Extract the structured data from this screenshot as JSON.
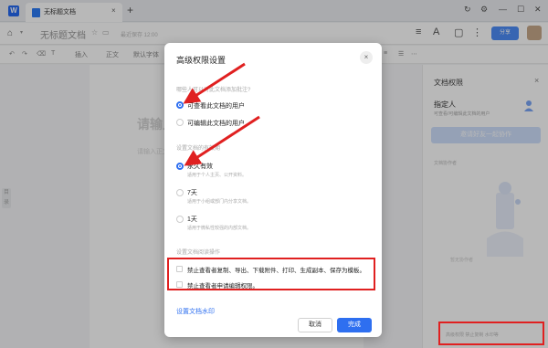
{
  "titlebar": {
    "tab_label": "无标题文档",
    "tab_close": "×",
    "new_tab": "+",
    "ctrl_sync": "↻",
    "ctrl_settings": "⚙",
    "ctrl_min": "—",
    "ctrl_max": "☐",
    "ctrl_close": "✕"
  },
  "header": {
    "doc_title": "无标题文档",
    "save_status": "最近保存 12:00",
    "share_label": "分享"
  },
  "toolbar": {
    "items": [
      "↶",
      "↷",
      "⌫",
      "T",
      "插入",
      "正文",
      "默认字体",
      "11",
      "B",
      "I",
      "U",
      "S",
      "A",
      "≡",
      "☰",
      "⋯"
    ]
  },
  "editor": {
    "title_placeholder": "请输入标题",
    "body_placeholder": "请输入正文",
    "handle_label": "目录"
  },
  "right_panel": {
    "title": "文档权限",
    "assign_label": "指定人",
    "assign_sub": "可查看/可编辑此文档的用户",
    "invite_label": "邀请好友一起协作",
    "section_label": "文档协作者",
    "empty_text": "暂无协作者",
    "footer": "高级权限  禁止复制  水印等"
  },
  "dialog": {
    "title": "高级权限设置",
    "close": "×",
    "q_comment": "哪些人可以对此文档添加批注?",
    "opt_viewers": "可查看此文档的用户",
    "opt_editors": "可编辑此文档的用户",
    "q_validity": "设置文档的有效期",
    "opt_forever": "永久有效",
    "opt_forever_sub": "适用于个人主页、公开资料。",
    "opt_7days": "7天",
    "opt_7days_sub": "适用于小组或部门内分享文档。",
    "opt_1day": "1天",
    "opt_1day_sub": "适用于微私性较强的内部文档。",
    "q_viewer_ops": "设置文档阅读操作",
    "chk_forbid_copy": "禁止查看者复制、导出、下载附件、打印、生成副本、保存为模板。",
    "chk_forbid_request": "禁止查看者申请编辑权限。",
    "watermark_link": "设置文档水印",
    "cancel": "取消",
    "done": "完成"
  },
  "colors": {
    "accent": "#2e6ff0",
    "annotation": "#e02020"
  }
}
